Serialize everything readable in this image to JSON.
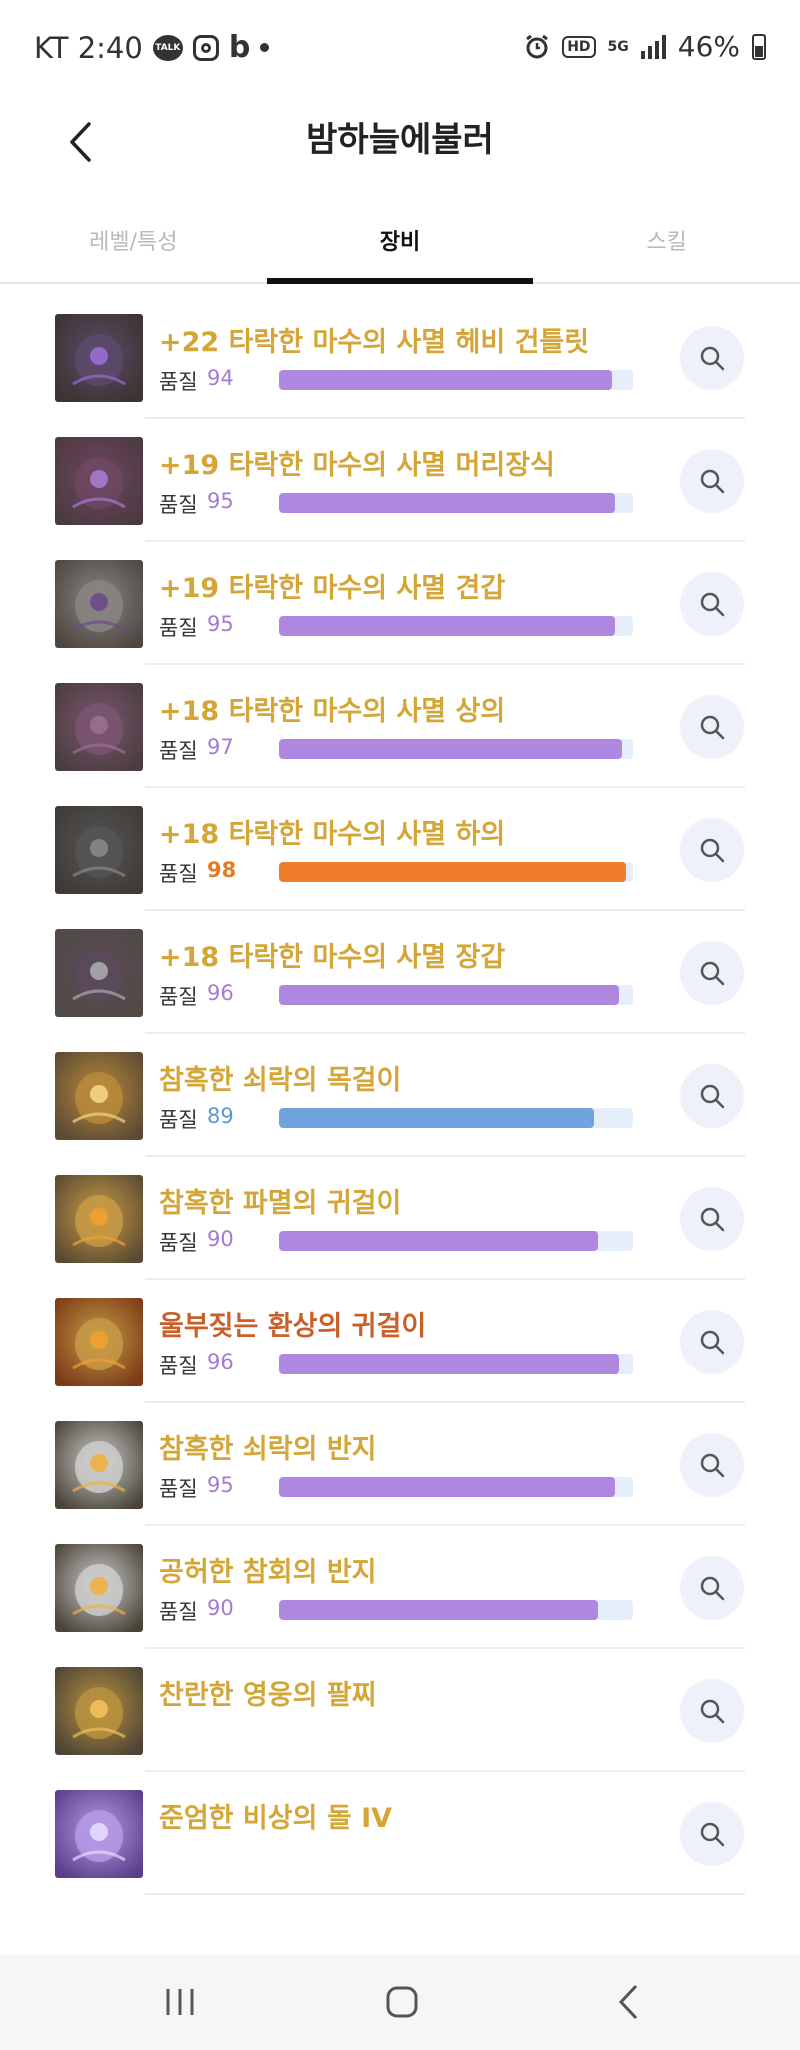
{
  "status_bar": {
    "carrier_time": "KT 2:40",
    "talk_badge": "TALK",
    "b_icon": "b",
    "hd": "HD",
    "network": "5G",
    "battery": "46%",
    "icons": [
      "talk-icon",
      "instagram-icon",
      "band-icon",
      "dot-icon",
      "alarm-icon",
      "hd-icon",
      "5g-icon",
      "signal-icon",
      "battery-icon"
    ]
  },
  "header": {
    "title": "밤하늘에불러",
    "back_icon": "chevron-left-icon"
  },
  "tabs": [
    {
      "label": "레벨/특성",
      "active": false
    },
    {
      "label": "장비",
      "active": true
    },
    {
      "label": "스킬",
      "active": false
    }
  ],
  "quality_label": "품질",
  "colors": {
    "name_gold": "#d4a537",
    "name_orange": "#c95f2a",
    "bar_purple": "#ad87e0",
    "bar_orange": "#ef7d2a",
    "bar_blue": "#6fa4de",
    "bar_track": "#e7eefb"
  },
  "items": [
    {
      "name": "+22 타락한 마수의 사멸 헤비 건틀릿",
      "quality": "94",
      "quality_fraction": 0.94,
      "tier": "purple",
      "icon": "gauntlet-icon"
    },
    {
      "name": "+19 타락한 마수의 사멸 머리장식",
      "quality": "95",
      "quality_fraction": 0.95,
      "tier": "purple",
      "icon": "hood-icon"
    },
    {
      "name": "+19 타락한 마수의 사멸 견갑",
      "quality": "95",
      "quality_fraction": 0.95,
      "tier": "purple",
      "icon": "shoulder-icon"
    },
    {
      "name": "+18 타락한 마수의 사멸 상의",
      "quality": "97",
      "quality_fraction": 0.97,
      "tier": "purple",
      "icon": "chest-armor-icon"
    },
    {
      "name": "+18 타락한 마수의 사멸 하의",
      "quality": "98",
      "quality_fraction": 0.98,
      "tier": "orange",
      "icon": "pants-icon"
    },
    {
      "name": "+18 타락한 마수의 사멸 장갑",
      "quality": "96",
      "quality_fraction": 0.96,
      "tier": "purple",
      "icon": "glove-icon"
    },
    {
      "name": "참혹한 쇠락의 목걸이",
      "quality": "89",
      "quality_fraction": 0.89,
      "tier": "blue",
      "icon": "necklace-icon"
    },
    {
      "name": "참혹한 파멸의 귀걸이",
      "quality": "90",
      "quality_fraction": 0.9,
      "tier": "purple",
      "icon": "earring-icon"
    },
    {
      "name": "울부짖는 환상의 귀걸이",
      "quality": "96",
      "quality_fraction": 0.96,
      "tier": "purple",
      "name_color": "orange",
      "icon": "earring-icon"
    },
    {
      "name": "참혹한 쇠락의 반지",
      "quality": "95",
      "quality_fraction": 0.95,
      "tier": "purple",
      "icon": "ring-icon"
    },
    {
      "name": "공허한 참회의 반지",
      "quality": "90",
      "quality_fraction": 0.9,
      "tier": "purple",
      "icon": "ring-icon"
    },
    {
      "name": "찬란한 영웅의 팔찌",
      "icon": "bracelet-icon"
    },
    {
      "name": "준엄한 비상의 돌 IV",
      "icon": "ability-stone-icon"
    }
  ],
  "nav_bar": {
    "icons": [
      "recent-apps-icon",
      "home-icon",
      "back-icon"
    ]
  }
}
